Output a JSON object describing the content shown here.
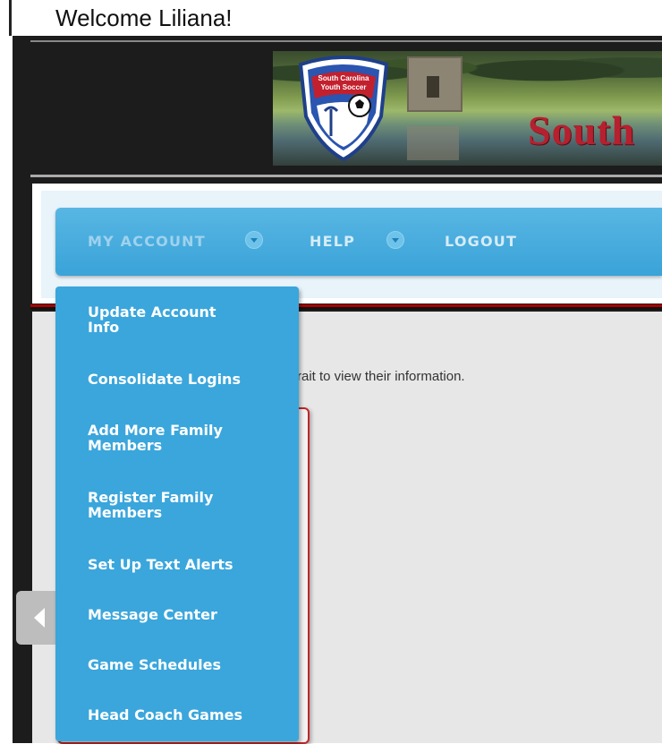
{
  "header": {
    "welcome": "Welcome Liliana!"
  },
  "banner": {
    "brand_text": "South",
    "logo_text_line1": "South Carolina",
    "logo_text_line2": "Youth Soccer"
  },
  "nav": {
    "items": [
      {
        "label": "MY ACCOUNT",
        "has_caret": true,
        "active": true
      },
      {
        "label": "HELP",
        "has_caret": true,
        "active": false
      },
      {
        "label": "LOGOUT",
        "has_caret": false,
        "active": false
      }
    ]
  },
  "dropdown": {
    "items": [
      {
        "line1": "Update Account",
        "line2": "Info"
      },
      {
        "line1": "Consolidate Logins",
        "line2": ""
      },
      {
        "line1": "Add More Family",
        "line2": "Members"
      },
      {
        "line1": "Register Family",
        "line2": "Members"
      },
      {
        "line1": "Set Up Text Alerts",
        "line2": ""
      },
      {
        "line1": "Message Center",
        "line2": ""
      },
      {
        "line1": "Game Schedules",
        "line2": ""
      },
      {
        "line1": "Head Coach Games",
        "line2": ""
      }
    ]
  },
  "content": {
    "instruction_fragment": "rait to view their information."
  },
  "colors": {
    "nav_blue": "#3aa3d8",
    "dropdown_blue": "#3aa6dc",
    "brand_red": "#b7202e",
    "frame_dark": "#1c1c1c"
  },
  "icons": {
    "nav_caret": "chevron-down-icon",
    "side_arrow": "chevron-left-icon",
    "logo": "south-carolina-youth-soccer-logo"
  }
}
